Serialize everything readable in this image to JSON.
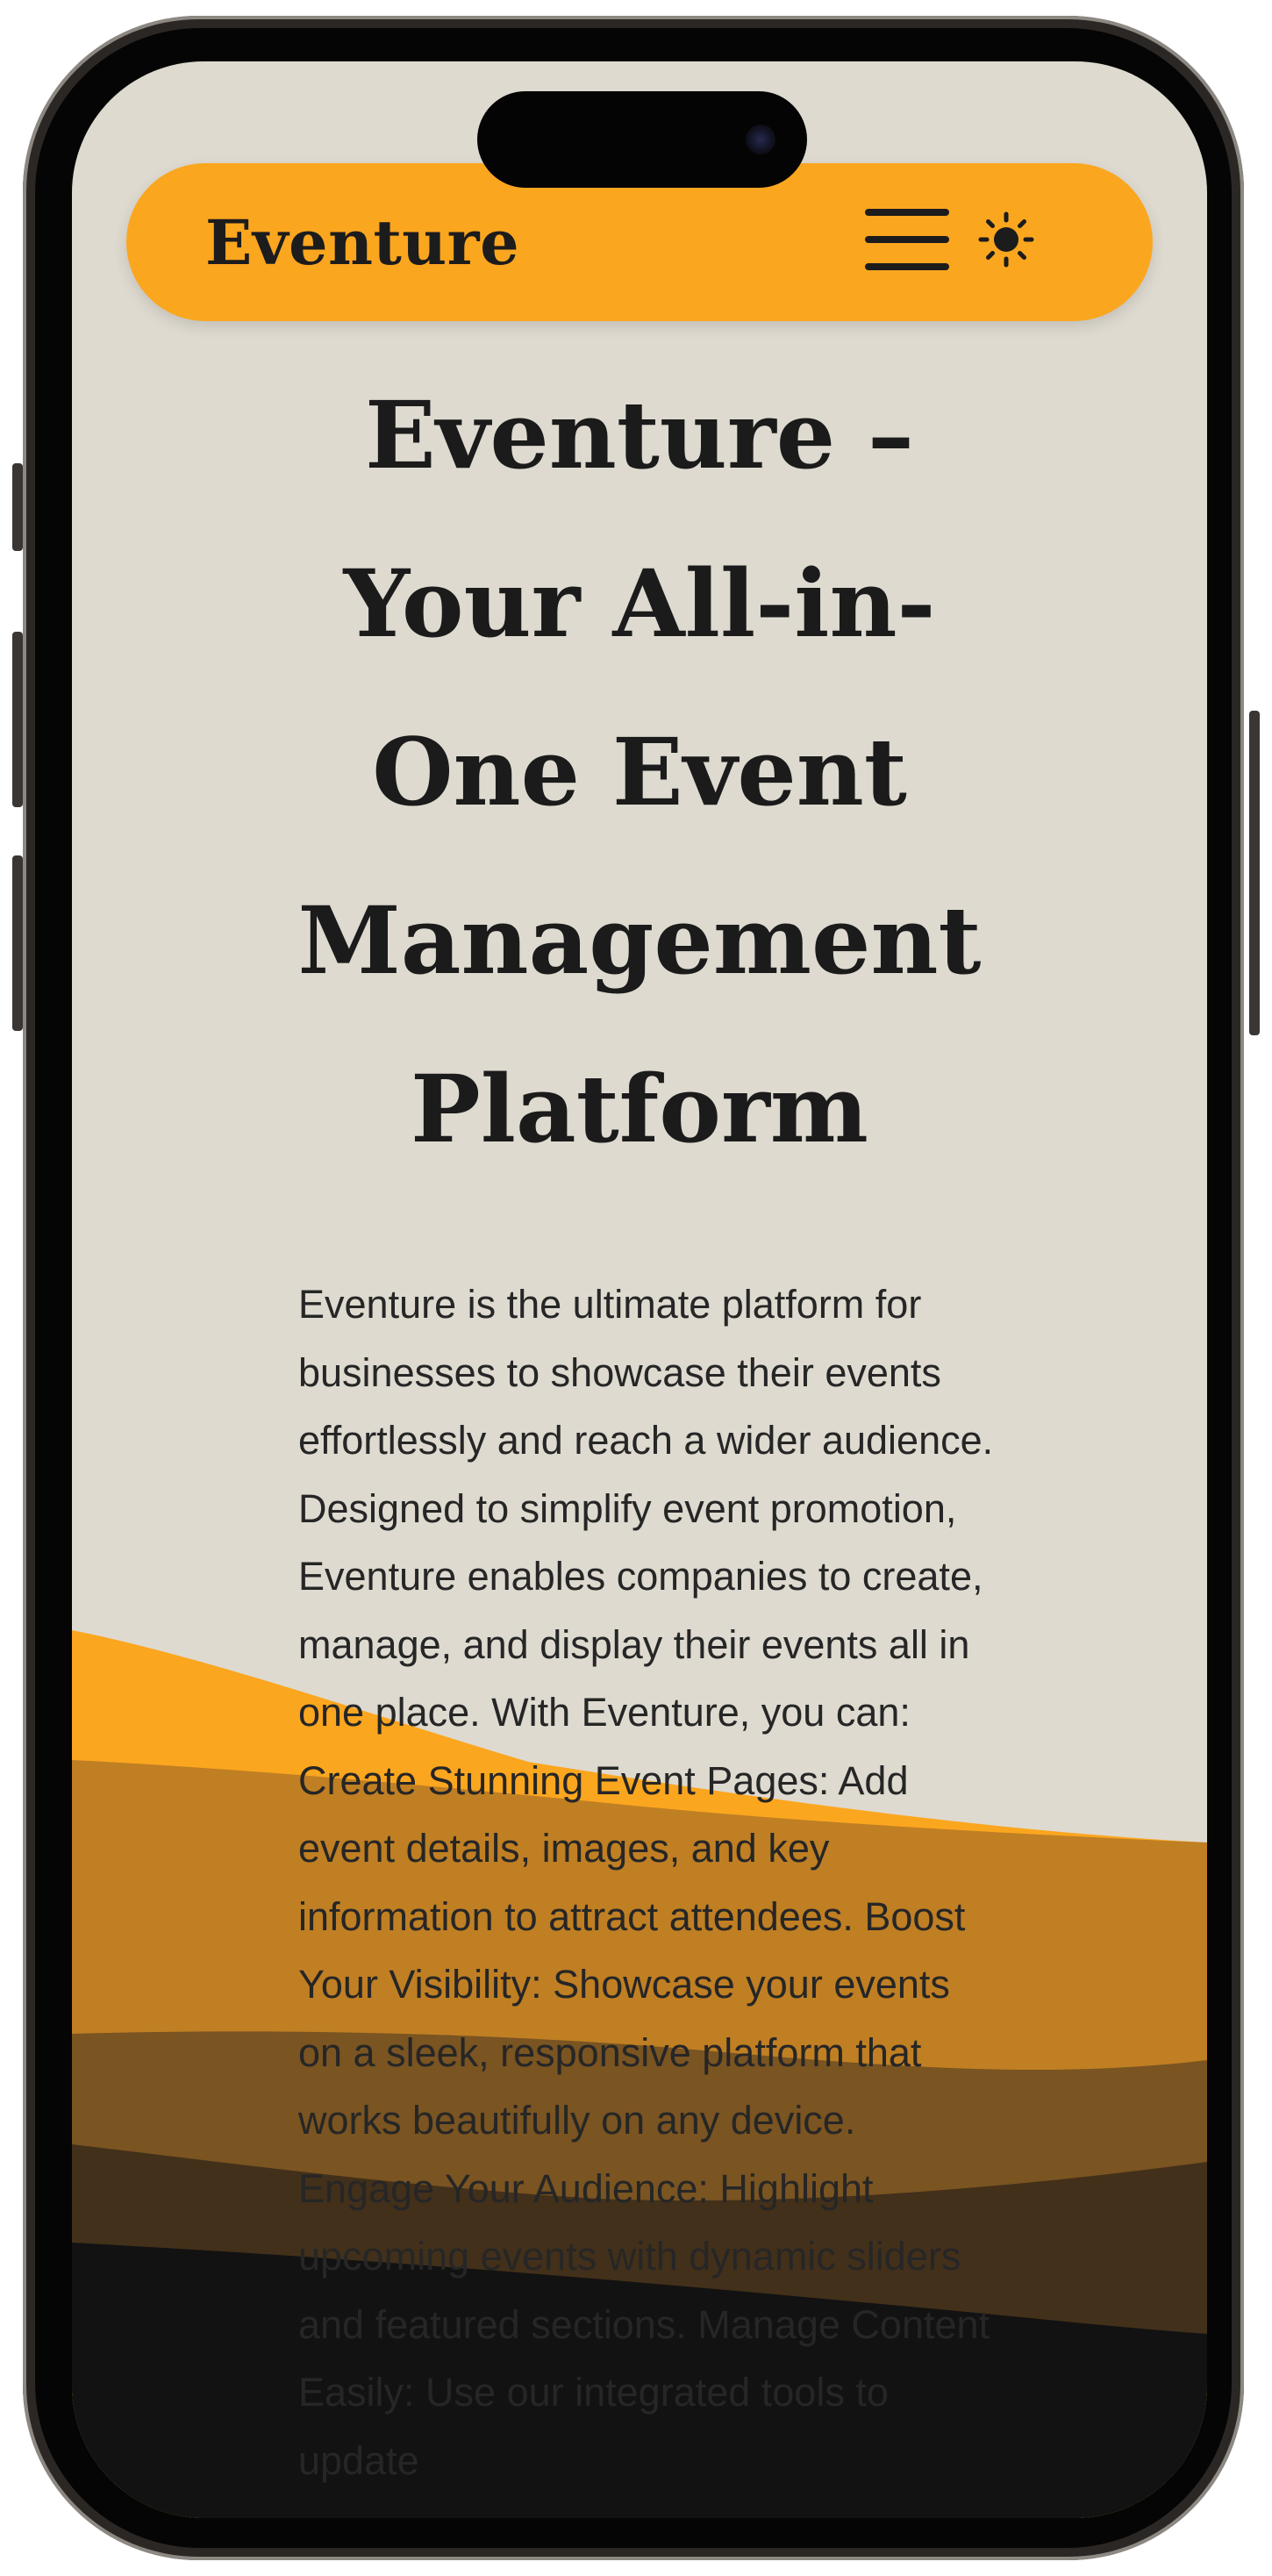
{
  "navbar": {
    "brand": "Eventure",
    "menu_icon": "hamburger-menu-icon",
    "theme_icon": "sun-icon"
  },
  "hero": {
    "title": "Eventure – Your All-in-One Event Management Platform",
    "description": "Eventure is the ultimate platform for businesses to showcase their events effortlessly and reach a wider audience. Designed to simplify event promotion, Eventure enables companies to create, manage, and display their events all in one place. With Eventure, you can: Create Stunning Event Pages: Add event details, images, and key information to attract attendees. Boost Your Visibility: Showcase your events on a sleek, responsive platform that works beautifully on any device. Engage Your Audience: Highlight upcoming events with dynamic sliders and featured sections. Manage Content Easily: Use our integrated tools to update"
  },
  "colors": {
    "accent": "#fba61f",
    "background": "#dedad0",
    "text": "#1b1b1b",
    "wave_orange": "#fba61f",
    "wave_amber": "#c07f23",
    "wave_brown": "#7a5421",
    "wave_dark_brown": "#43301a",
    "wave_black": "#121212"
  }
}
